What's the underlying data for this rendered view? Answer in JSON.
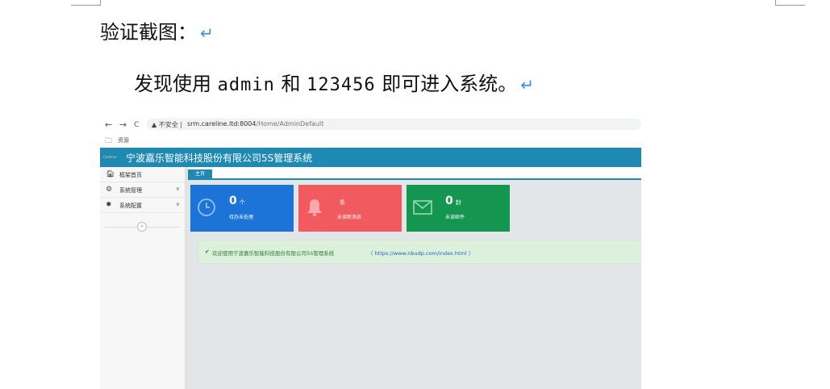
{
  "document": {
    "heading": "验证截图：",
    "para_before": "发现使用 ",
    "username": "admin",
    "para_mid": " 和 ",
    "password": "123456",
    "para_after": " 即可进入系统。",
    "return_mark": "↵"
  },
  "browser": {
    "back": "←",
    "forward": "→",
    "reload": "C",
    "security_label": "▲ 不安全 |",
    "host": "srm.careline.ltd:8004",
    "path": "/Home/AdminDefault",
    "bookmark_folder_icon": "folder-icon",
    "bookmark_label": "资源"
  },
  "app": {
    "title": "宁波嘉乐智能科技股份有限公司5S管理系统",
    "logo_text": "Careline",
    "sidebar": [
      {
        "label": "框架首页",
        "icon": "home-icon",
        "has_chevron": false
      },
      {
        "label": "系统管理",
        "icon": "gears-icon",
        "has_chevron": true
      },
      {
        "label": "系统配置",
        "icon": "gear-icon",
        "has_chevron": true
      }
    ],
    "collapse_symbol": "«",
    "tab_label": "主页",
    "cards": [
      {
        "count": "0",
        "unit": "个",
        "label": "待办未处理",
        "color": "#1c74d8",
        "icon": "clock-icon"
      },
      {
        "count": "",
        "unit": "条",
        "label": "未读新消息",
        "color": "#f15a5f",
        "icon": "bell-icon"
      },
      {
        "count": "0",
        "unit": "封",
        "label": "未读邮件",
        "color": "#149651",
        "icon": "envelope-icon"
      }
    ],
    "welcome_check": "✔",
    "welcome_text": "欢迎使用宁波嘉乐智能科技股份有限公司5S管理系统",
    "welcome_link": "（ https://www.nbudp.com/index.html ）"
  },
  "colors": {
    "header": "#1e8ab4",
    "card_blue": "#1c74d8",
    "card_red": "#f15a5f",
    "card_green": "#149651",
    "return_mark": "#3a8ee6"
  }
}
